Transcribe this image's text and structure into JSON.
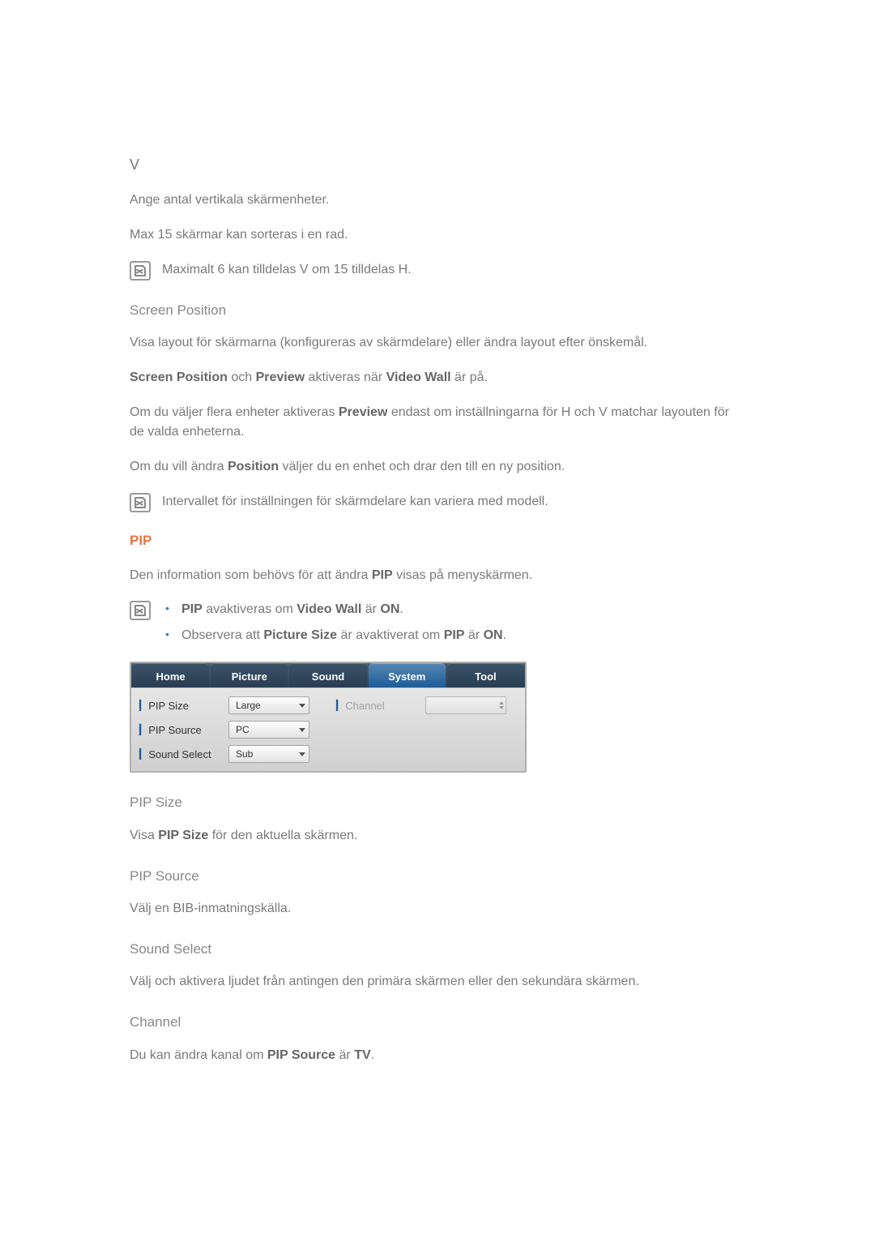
{
  "v_section": {
    "heading": "V",
    "desc": "Ange antal vertikala skärmenheter.",
    "max": "Max 15 skärmar kan sorteras i en rad.",
    "note": "Maximalt 6 kan tilldelas V om 15 tilldelas H."
  },
  "screen_position": {
    "heading": "Screen Position",
    "p1": "Visa layout för skärmarna (konfigureras av skärmdelare) eller ändra layout efter önskemål.",
    "p2_pre": "Screen Position",
    "p2_mid": " och ",
    "p2_bold2": "Preview",
    "p2_mid2": " aktiveras när ",
    "p2_bold3": "Video Wall",
    "p2_end": " är på.",
    "p3_pre": "Om du väljer flera enheter aktiveras ",
    "p3_bold": "Preview",
    "p3_end": " endast om inställningarna för H och V matchar layouten för de valda enheterna.",
    "p4_pre": "Om du vill ändra ",
    "p4_bold": "Position",
    "p4_end": " väljer du en enhet och drar den till en ny position.",
    "note": "Intervallet för inställningen för skärmdelare kan variera med modell."
  },
  "pip": {
    "heading": "PIP",
    "intro_pre": "Den information som behövs för att ändra ",
    "intro_bold": "PIP",
    "intro_end": " visas på menyskärmen.",
    "bullet1_b1": "PIP",
    "bullet1_t1": " avaktiveras om ",
    "bullet1_b2": "Video Wall",
    "bullet1_t2": " är ",
    "bullet1_b3": "ON",
    "bullet1_end": ".",
    "bullet2_t1": "Observera att ",
    "bullet2_b1": "Picture Size",
    "bullet2_t2": " är avaktiverat om ",
    "bullet2_b2": "PIP",
    "bullet2_t3": " är ",
    "bullet2_b3": "ON",
    "bullet2_end": "."
  },
  "ui": {
    "tabs": {
      "home": "Home",
      "picture": "Picture",
      "sound": "Sound",
      "system": "System",
      "tool": "Tool"
    },
    "fields": {
      "pip_size_label": "PIP Size",
      "pip_size_value": "Large",
      "pip_source_label": "PIP Source",
      "pip_source_value": "PC",
      "sound_select_label": "Sound Select",
      "sound_select_value": "Sub",
      "channel_label": "Channel"
    }
  },
  "subsections": {
    "pip_size_h": "PIP Size",
    "pip_size_p_pre": "Visa ",
    "pip_size_p_bold": "PIP Size",
    "pip_size_p_end": " för den aktuella skärmen.",
    "pip_source_h": "PIP Source",
    "pip_source_p": "Välj en BIB-inmatningskälla.",
    "sound_select_h": "Sound Select",
    "sound_select_p": "Välj och aktivera ljudet från antingen den primära skärmen eller den sekundära skärmen.",
    "channel_h": "Channel",
    "channel_p_pre": "Du kan ändra kanal om ",
    "channel_p_b1": "PIP Source",
    "channel_p_mid": " är ",
    "channel_p_b2": "TV",
    "channel_p_end": "."
  }
}
